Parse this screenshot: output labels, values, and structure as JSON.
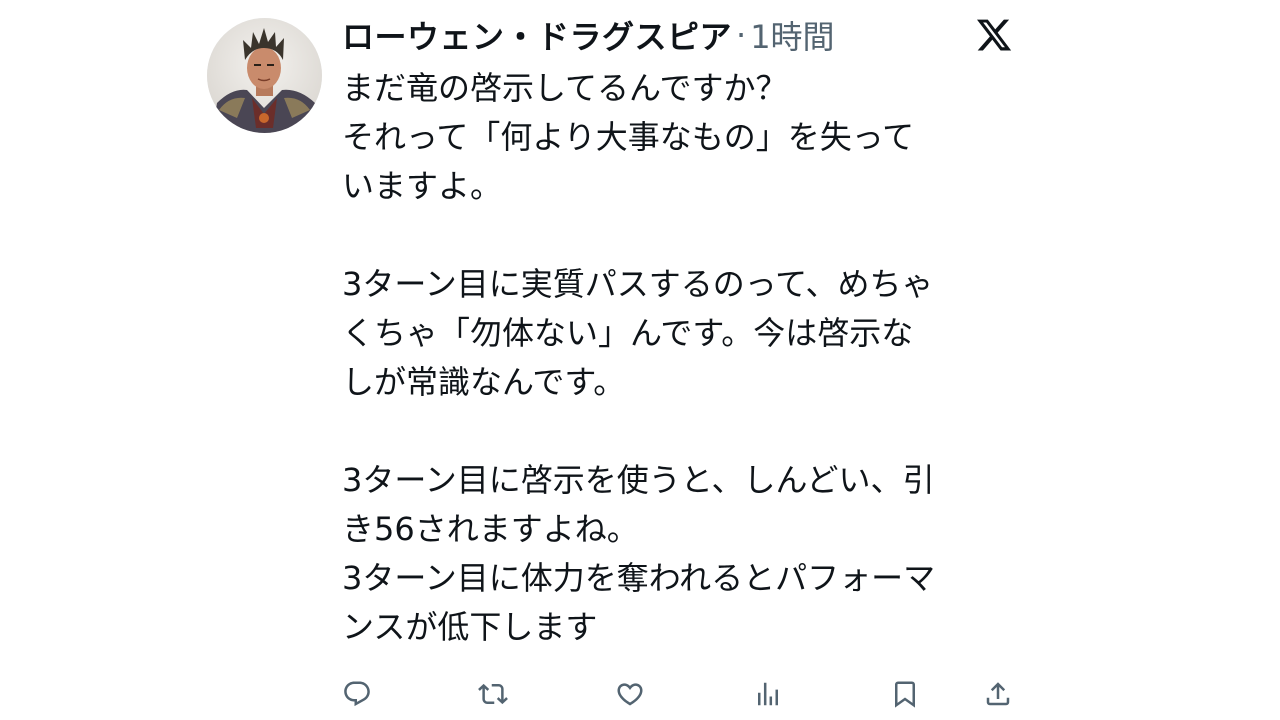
{
  "tweet": {
    "author_name": "ローウェン・ドラグスピア",
    "separator": "·",
    "time_ago": "1時間",
    "body": {
      "paragraph1": [
        "まだ竜の啓示してるんですか？",
        "それって「何より大事なもの」を失って",
        "いますよ。"
      ],
      "paragraph2": [
        "3ターン目に実質パスするのって、めちゃ",
        "くちゃ「勿体ない」んです。今は啓示な",
        "しが常識なんです。"
      ],
      "paragraph3": [
        "3ターン目に啓示を使うと、しんどい、引",
        "き56されますよね。",
        "3ターン目に体力を奪われるとパフォーマ",
        "ンスが低下します"
      ]
    }
  },
  "icons": {
    "platform_logo": "x-logo-icon",
    "avatar": "avatar-image",
    "actions": [
      "reply-icon",
      "retweet-icon",
      "like-icon",
      "views-icon",
      "bookmark-icon",
      "share-icon"
    ]
  },
  "colors": {
    "text": "#0f1419",
    "meta": "#536471",
    "icon": "#536471"
  }
}
